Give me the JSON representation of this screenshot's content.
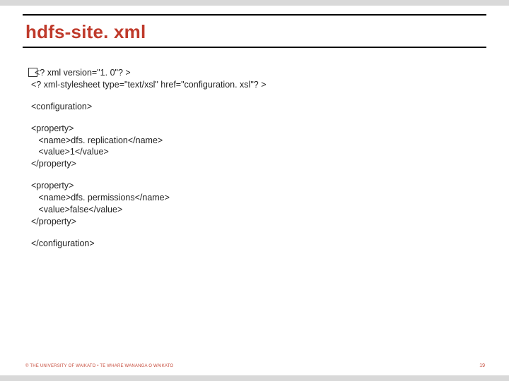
{
  "title": "hdfs-site. xml",
  "xml": {
    "decl_line": "<? xml version=\"1. 0\"? >",
    "stylesheet_line": "<? xml-stylesheet type=\"text/xsl\" href=\"configuration. xsl\"? >",
    "config_open": "<configuration>",
    "prop1": "<property>\n   <name>dfs. replication</name>\n   <value>1</value>\n</property>",
    "prop2": "<property>\n   <name>dfs. permissions</name>\n   <value>false</value>\n</property>",
    "config_close": "</configuration>"
  },
  "footer": "© THE UNIVERSITY OF WAIKATO  •  TE WHARE WANANGA O WAIKATO",
  "page_number": "19"
}
